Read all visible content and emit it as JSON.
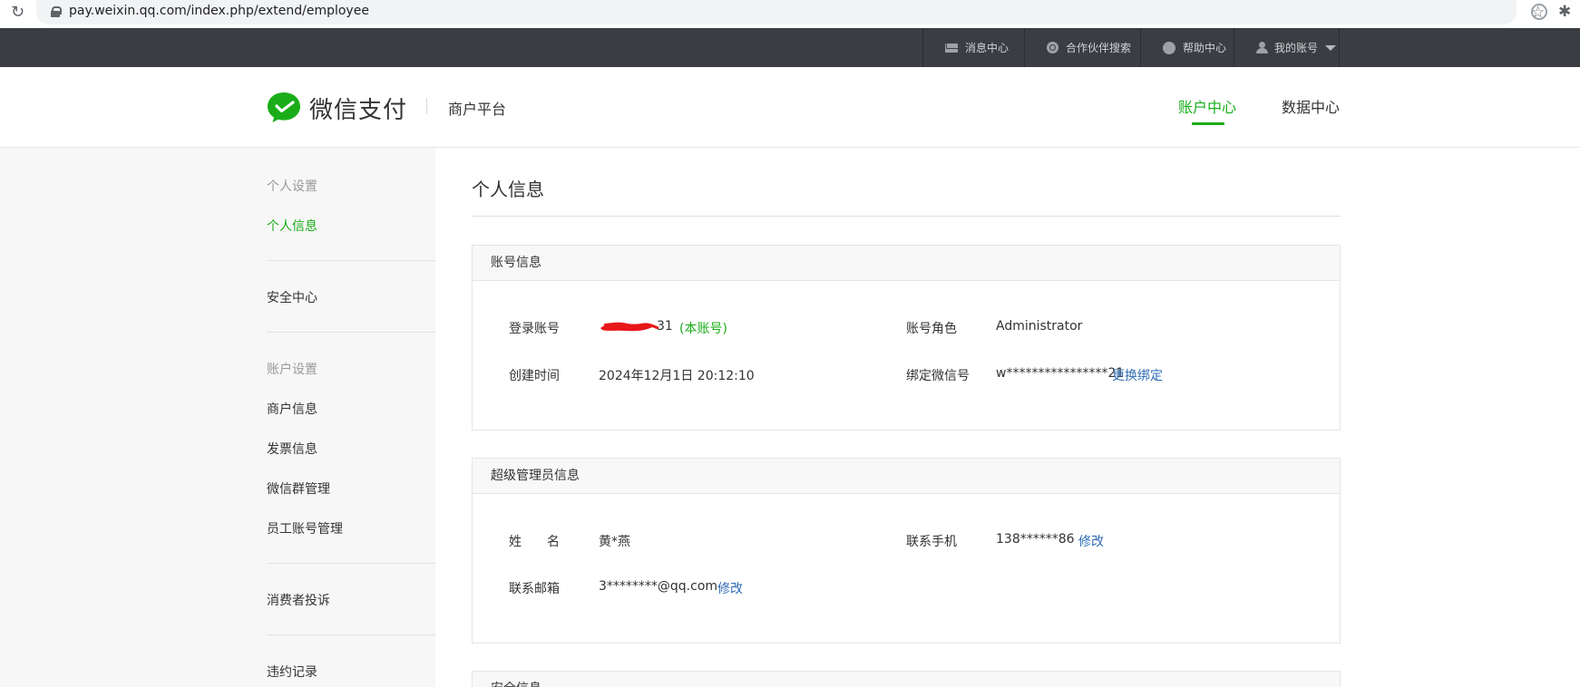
{
  "browser": {
    "url": "pay.weixin.qq.com/index.php/extend/employee"
  },
  "topnav": {
    "items": [
      {
        "label": "消息中心",
        "icon": "mail-icon"
      },
      {
        "label": "合作伙伴搜索",
        "icon": "search-circle-icon"
      },
      {
        "label": "帮助中心",
        "icon": "help-icon"
      },
      {
        "label": "我的账号",
        "icon": "user-icon"
      }
    ]
  },
  "header": {
    "logo_text": "微信支付",
    "platform": "商户平台",
    "tabs": [
      {
        "label": "账户中心",
        "active": true
      },
      {
        "label": "数据中心",
        "active": false
      }
    ]
  },
  "sidebar": {
    "group_personal": "个人设置",
    "personal_info": "个人信息",
    "security_center": "安全中心",
    "group_account": "账户设置",
    "merchant_info": "商户信息",
    "invoice_info": "发票信息",
    "wechat_group": "微信群管理",
    "staff_accounts": "员工账号管理",
    "consumer_complaints": "消费者投诉",
    "violation_records": "违约记录"
  },
  "main": {
    "title": "个人信息",
    "account_card": {
      "title": "账号信息",
      "login_label": "登录账号",
      "login_value_suffix": "31",
      "login_tag": "(本账号)",
      "role_label": "账号角色",
      "role_value": "Administrator",
      "created_label": "创建时间",
      "created_value": "2024年12月1日 20:12:10",
      "wechat_label": "绑定微信号",
      "wechat_value": "w****************21",
      "wechat_action": "更换绑定"
    },
    "admin_card": {
      "title": "超级管理员信息",
      "name_label": "姓　　名",
      "name_value": "黄*燕",
      "phone_label": "联系手机",
      "phone_value": "138******86",
      "phone_action": "修改",
      "email_label": "联系邮箱",
      "email_value": "3********@qq.com",
      "email_action": "修改"
    },
    "security_card": {
      "title": "安全信息"
    }
  },
  "colors": {
    "brand_green": "#1aad19",
    "link_blue": "#2d6ab4",
    "topnav_bg": "#3a3d42",
    "sidebar_bg": "#f7f7f7"
  }
}
